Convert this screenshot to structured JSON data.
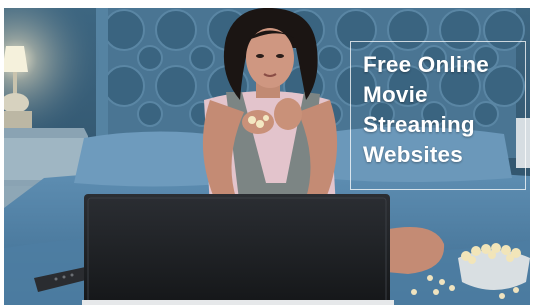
{
  "overlay": {
    "title_lines": [
      "Free Online",
      "Movie",
      "Streaming",
      "Websites"
    ]
  },
  "scene": {
    "description_icon": "photo-woman-watching-laptop",
    "colors": {
      "wall": "#3a617c",
      "wall_dark": "#22384a",
      "bed": "#4f7fa3",
      "laptop": "#1d1f22",
      "lamp": "#f3efd9",
      "skin": "#c9907a",
      "top": "#e7c9cf",
      "scarf": "#77807f",
      "hair": "#1a1412",
      "popcorn": "#f2e5b9"
    }
  }
}
